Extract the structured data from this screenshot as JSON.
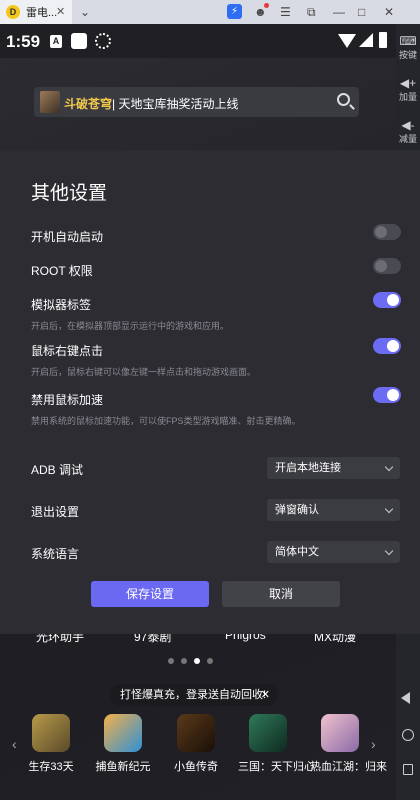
{
  "window": {
    "tab_title": "雷电...",
    "tab_logo": "D",
    "tab_close": "✕",
    "tab_dropdown": "⌄",
    "controls": [
      "⚡",
      "☻",
      "☰",
      "⧉",
      "—",
      "□",
      "✕"
    ]
  },
  "status_bar": {
    "time": "1:59",
    "a_badge": "A"
  },
  "right_toolbar": {
    "items": [
      {
        "icon": "keyboard-icon",
        "glyph": "⌨",
        "label": "按键"
      },
      {
        "icon": "volume-up-icon",
        "glyph": "◀+",
        "label": "加量"
      },
      {
        "icon": "volume-down-icon",
        "glyph": "◀-",
        "label": "减量"
      }
    ],
    "close": "✕"
  },
  "home": {
    "search": {
      "highlight": "斗破苍穹",
      "text": "| 天地宝库抽奖活动上线"
    },
    "top_apps": [
      "光环助手",
      "97泰剧",
      "Phigros",
      "MX动漫"
    ],
    "toast": {
      "text": "打怪爆真充，登录送自动回收!",
      "close": "✕"
    },
    "nav_left": "‹",
    "nav_right": "›",
    "games": [
      {
        "name": "生存33天",
        "color": "#7a6a3a"
      },
      {
        "name": "捕鱼新纪元",
        "color": "#e08a2a"
      },
      {
        "name": "小鱼传奇",
        "color": "#3a2a1a"
      },
      {
        "name": "三国：天下归心",
        "color": "#1f5c4a"
      },
      {
        "name": "热血江湖：归来",
        "color": "#d9a3b0"
      }
    ]
  },
  "dialog": {
    "title": "其他设置",
    "options": [
      {
        "label": "开机自动启动",
        "desc": "",
        "on": false
      },
      {
        "label": "ROOT 权限",
        "desc": "",
        "on": false
      },
      {
        "label": "模拟器标签",
        "desc": "开启后，在模拟器顶部显示运行中的游戏和应用。",
        "on": true
      },
      {
        "label": "鼠标右键点击",
        "desc": "开启后，鼠标右键可以像左键一样点击和拖动游戏画面。",
        "on": true
      },
      {
        "label": "禁用鼠标加速",
        "desc": "禁用系统的鼠标加速功能，可以使FPS类型游戏瞄准、射击更精确。",
        "on": true
      }
    ],
    "selects": [
      {
        "label": "ADB 调试",
        "value": "开启本地连接"
      },
      {
        "label": "退出设置",
        "value": "弹窗确认"
      },
      {
        "label": "系统语言",
        "value": "简体中文"
      }
    ],
    "save_label": "保存设置",
    "cancel_label": "取消"
  },
  "colors": {
    "accent": "#6b68f2",
    "dialog_bg": "#2c2c32",
    "highlight_text": "#f2c94c"
  }
}
